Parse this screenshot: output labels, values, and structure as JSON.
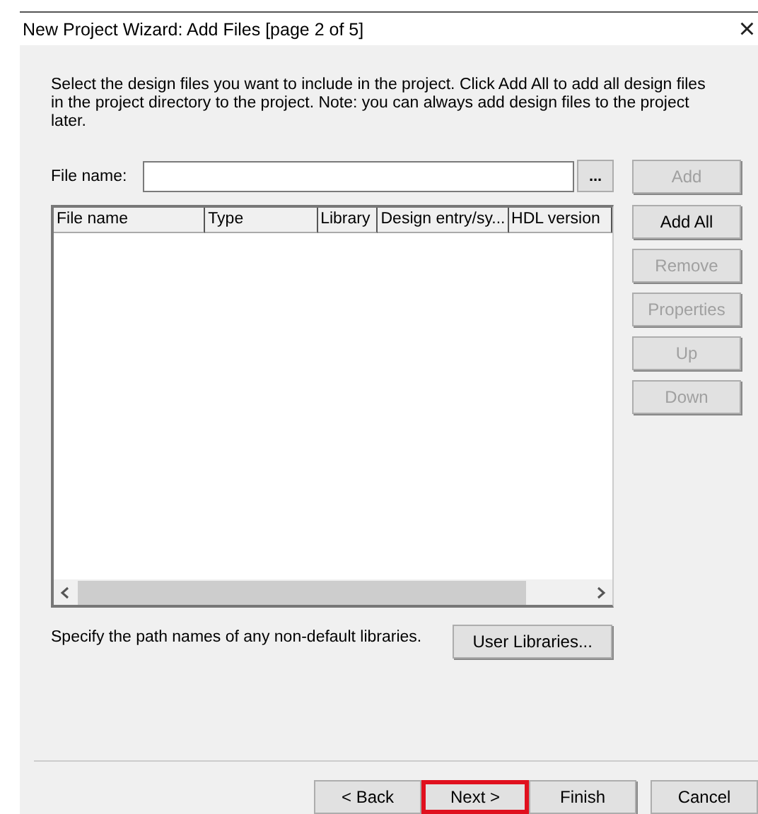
{
  "window": {
    "title": "New Project Wizard: Add Files [page 2 of 5]",
    "close": "×"
  },
  "description": "Select the design files you want to include in the project. Click Add All to add all design files in the project directory to the project. Note: you can always add design files to the project later.",
  "file_field": {
    "label": "File name:",
    "browse": "..."
  },
  "table": {
    "columns": [
      "File name",
      "Type",
      "Library",
      "Design entry/sy...",
      "HDL version"
    ]
  },
  "side_buttons": [
    {
      "label": "Add",
      "disabled": true
    },
    {
      "label": "Add All",
      "disabled": false
    },
    {
      "label": "Remove",
      "disabled": true
    },
    {
      "label": "Properties",
      "disabled": true
    },
    {
      "label": "Up",
      "disabled": true
    },
    {
      "label": "Down",
      "disabled": true
    }
  ],
  "libraries": {
    "text": "Specify the path names of any non-default libraries.",
    "button": "User Libraries..."
  },
  "footer_buttons": [
    {
      "label": "< Back",
      "highlighted": false
    },
    {
      "label": "Next >",
      "highlighted": true
    },
    {
      "label": "Finish",
      "highlighted": false
    },
    {
      "label": "Cancel",
      "highlighted": false
    }
  ]
}
